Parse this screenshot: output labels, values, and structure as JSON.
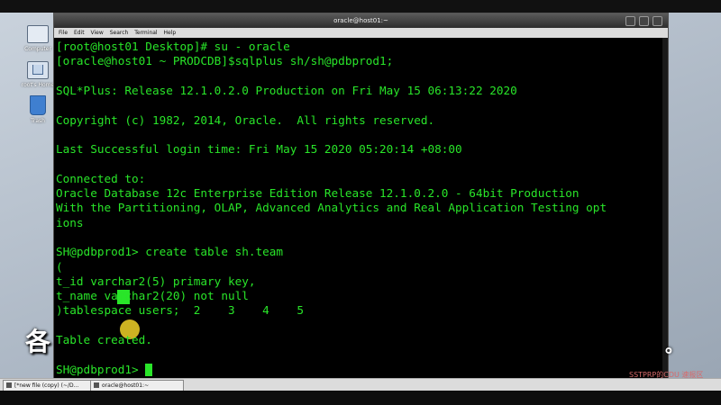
{
  "desktop": {
    "icons": [
      {
        "name": "Computer"
      },
      {
        "name": "root's Home"
      },
      {
        "name": "Trash"
      }
    ]
  },
  "window": {
    "title": "oracle@host01:~",
    "menu": [
      "File",
      "Edit",
      "View",
      "Search",
      "Terminal",
      "Help"
    ]
  },
  "terminal": {
    "lines": [
      "[root@host01 Desktop]# su - oracle",
      "[oracle@host01 ~ PRODCDB]$sqlplus sh/sh@pdbprod1;",
      "",
      "SQL*Plus: Release 12.1.0.2.0 Production on Fri May 15 06:13:22 2020",
      "",
      "Copyright (c) 1982, 2014, Oracle.  All rights reserved.",
      "",
      "Last Successful login time: Fri May 15 2020 05:20:14 +08:00",
      "",
      "Connected to:",
      "Oracle Database 12c Enterprise Edition Release 12.1.0.2.0 - 64bit Production",
      "With the Partitioning, OLAP, Advanced Analytics and Real Application Testing opt",
      "ions",
      "",
      "SH@pdbprod1> create table sh.team",
      "(",
      "t_id varchar2(5) primary key,",
      "t_name varchar2(20) not null",
      ")tablespace users;  2    3    4    5",
      "",
      "Table created.",
      "",
      "SH@pdbprod1> "
    ]
  },
  "taskbar": {
    "items": [
      {
        "label": "[*new file (copy) (~/D..."
      },
      {
        "label": "oracle@host01:~"
      }
    ]
  },
  "subtitles": {
    "left": "各",
    "right": "。"
  },
  "watermark": "SSTPRP的CDU 速报区"
}
